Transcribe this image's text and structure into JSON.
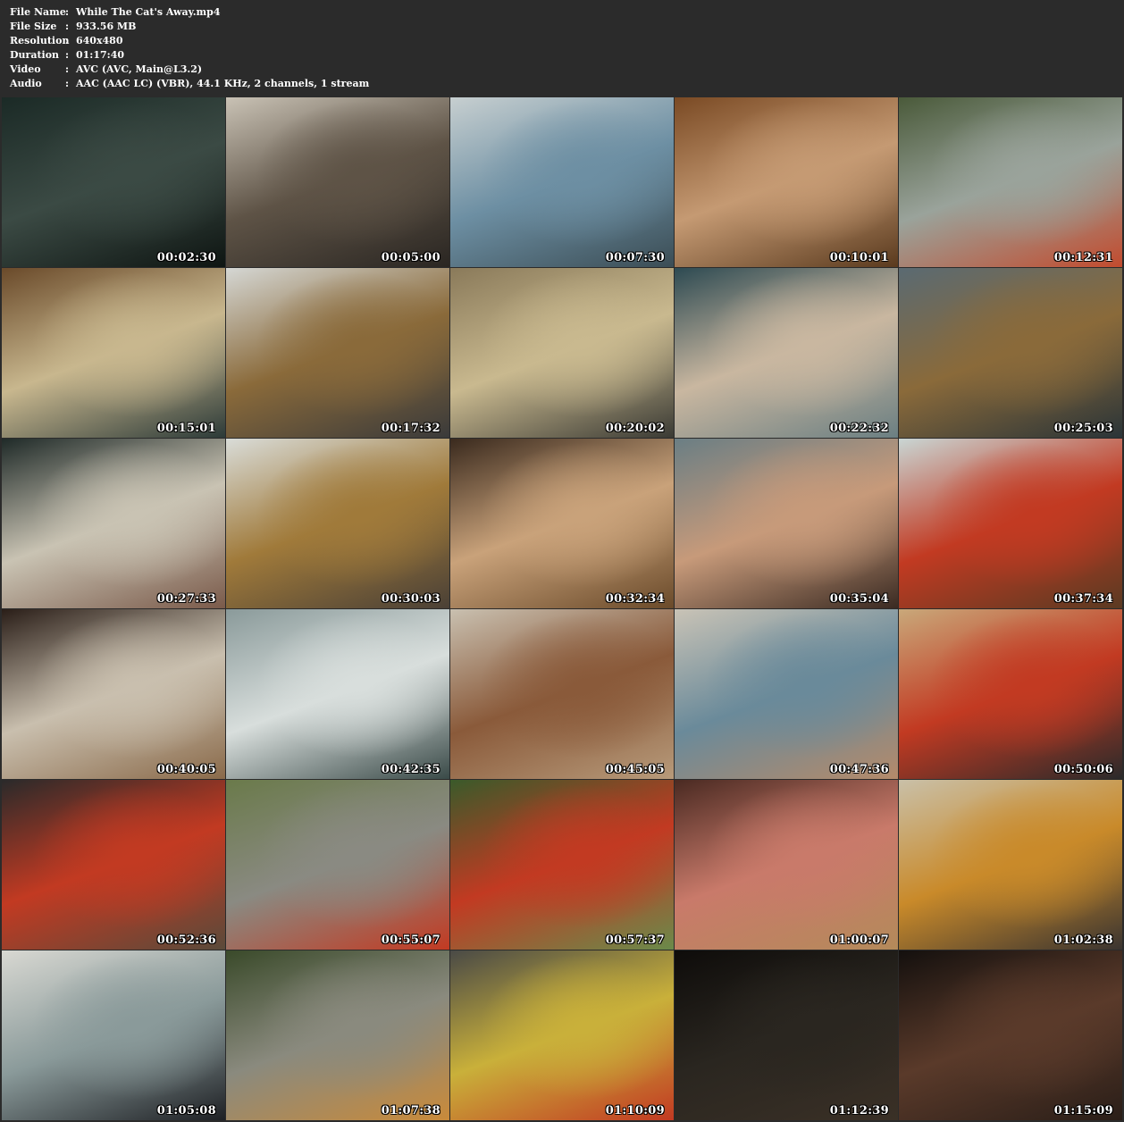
{
  "file_info": [
    {
      "label": "File Name",
      "value": "While The Cat's Away.mp4"
    },
    {
      "label": "File Size",
      "value": "933.56 MB"
    },
    {
      "label": "Resolution",
      "value": "640x480"
    },
    {
      "label": "Duration",
      "value": "01:17:40"
    },
    {
      "label": "Video",
      "value": "AVC (AVC, Main@L3.2)"
    },
    {
      "label": "Audio",
      "value": "AAC (AAC LC) (VBR), 44.1 KHz, 2 channels, 1 stream"
    }
  ],
  "separator": ":",
  "thumbnails": [
    {
      "time": "00:02:30",
      "colors": [
        "#1b2a26",
        "#3b4a44",
        "#0e1512"
      ]
    },
    {
      "time": "00:05:00",
      "colors": [
        "#c9c2b5",
        "#5e5346",
        "#2a2622"
      ]
    },
    {
      "time": "00:07:30",
      "colors": [
        "#c7cfd0",
        "#6d8fa3",
        "#3b4d55"
      ]
    },
    {
      "time": "00:10:01",
      "colors": [
        "#7a4a24",
        "#c59a73",
        "#5a3a1e"
      ]
    },
    {
      "time": "00:12:31",
      "colors": [
        "#4a5a3a",
        "#9aa39b",
        "#c24b2e"
      ]
    },
    {
      "time": "00:15:01",
      "colors": [
        "#6a4a2a",
        "#c8b78e",
        "#2c3a38"
      ]
    },
    {
      "time": "00:17:32",
      "colors": [
        "#d5d7d4",
        "#8a6a3a",
        "#3a3a3a"
      ]
    },
    {
      "time": "00:20:02",
      "colors": [
        "#8a7a5a",
        "#c9b98f",
        "#3a3a34"
      ]
    },
    {
      "time": "00:22:32",
      "colors": [
        "#2d4a52",
        "#c9b7a0",
        "#6b7f82"
      ]
    },
    {
      "time": "00:25:03",
      "colors": [
        "#5a6a72",
        "#8a6a3a",
        "#2a3438"
      ]
    },
    {
      "time": "00:27:33",
      "colors": [
        "#1f2a28",
        "#c9c3b3",
        "#7a5a4a"
      ]
    },
    {
      "time": "00:30:03",
      "colors": [
        "#d9dcd8",
        "#a07a3a",
        "#4a4036"
      ]
    },
    {
      "time": "00:32:34",
      "colors": [
        "#3a2a1e",
        "#c9a27a",
        "#6a4a2a"
      ]
    },
    {
      "time": "00:35:04",
      "colors": [
        "#6a7e84",
        "#c79a7a",
        "#3a2a22"
      ]
    },
    {
      "time": "00:37:34",
      "colors": [
        "#c9d6d4",
        "#c23a22",
        "#5a3a22"
      ]
    },
    {
      "time": "00:40:05",
      "colors": [
        "#2a1e18",
        "#c9bfae",
        "#8a6a4a"
      ]
    },
    {
      "time": "00:42:35",
      "colors": [
        "#8a9a9a",
        "#d8dedc",
        "#3a4a48"
      ]
    },
    {
      "time": "00:45:05",
      "colors": [
        "#c9c0b0",
        "#8a5a3a",
        "#b79a7a"
      ]
    },
    {
      "time": "00:47:36",
      "colors": [
        "#c9c3b6",
        "#6a8a9a",
        "#b48a6a"
      ]
    },
    {
      "time": "00:50:06",
      "colors": [
        "#c9a87a",
        "#c23a22",
        "#2a2a2a"
      ]
    },
    {
      "time": "00:52:36",
      "colors": [
        "#2a2a2a",
        "#c23a22",
        "#5a4a3a"
      ]
    },
    {
      "time": "00:55:07",
      "colors": [
        "#6a7a4a",
        "#8a8a82",
        "#c23a22"
      ]
    },
    {
      "time": "00:57:37",
      "colors": [
        "#3a5a2a",
        "#c23a22",
        "#6a8a4a"
      ]
    },
    {
      "time": "01:00:07",
      "colors": [
        "#4a2a22",
        "#c97a6a",
        "#b48a5a"
      ]
    },
    {
      "time": "01:02:38",
      "colors": [
        "#c9c0a8",
        "#c98a2a",
        "#3a3430"
      ]
    },
    {
      "time": "01:05:08",
      "colors": [
        "#d8d8d2",
        "#8a9a9a",
        "#1e2024"
      ]
    },
    {
      "time": "01:07:38",
      "colors": [
        "#3a4a2a",
        "#8a8a7e",
        "#c98a3a"
      ]
    },
    {
      "time": "01:10:09",
      "colors": [
        "#4a4a46",
        "#c9b03a",
        "#c23a22"
      ]
    },
    {
      "time": "01:12:39",
      "colors": [
        "#0e0c0a",
        "#2a2620",
        "#3a3026"
      ]
    },
    {
      "time": "01:15:09",
      "colors": [
        "#14100e",
        "#5a3a2a",
        "#2a1e18"
      ]
    }
  ]
}
